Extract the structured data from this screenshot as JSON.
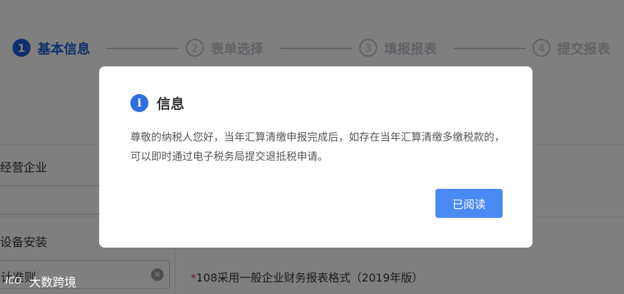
{
  "steps": [
    {
      "number": "1",
      "label": "基本信息",
      "active": true
    },
    {
      "number": "2",
      "label": "表单选择",
      "active": false
    },
    {
      "number": "3",
      "label": "填报报表",
      "active": false
    },
    {
      "number": "4",
      "label": "提交报表",
      "active": false
    }
  ],
  "form": {
    "row1_label": "经营企业",
    "row2_label": "设备安装",
    "row3_label": "计准则",
    "report_format_required": "*",
    "report_format_value": "108采用一般企业财务报表格式（2019年版）"
  },
  "dialog": {
    "title": "信息",
    "message": "尊敬的纳税人您好，当年汇算清缴申报完成后，如存在当年汇算清缴多缴税款的，可以即时通过电子税务局提交退抵税申请。",
    "confirm_label": "已阅读"
  },
  "watermark": {
    "logo_text": "ICO",
    "text": "大数跨境"
  },
  "colors": {
    "primary": "#1f5fd8",
    "button": "#4a8af4",
    "info_icon": "#2d6ee0"
  }
}
